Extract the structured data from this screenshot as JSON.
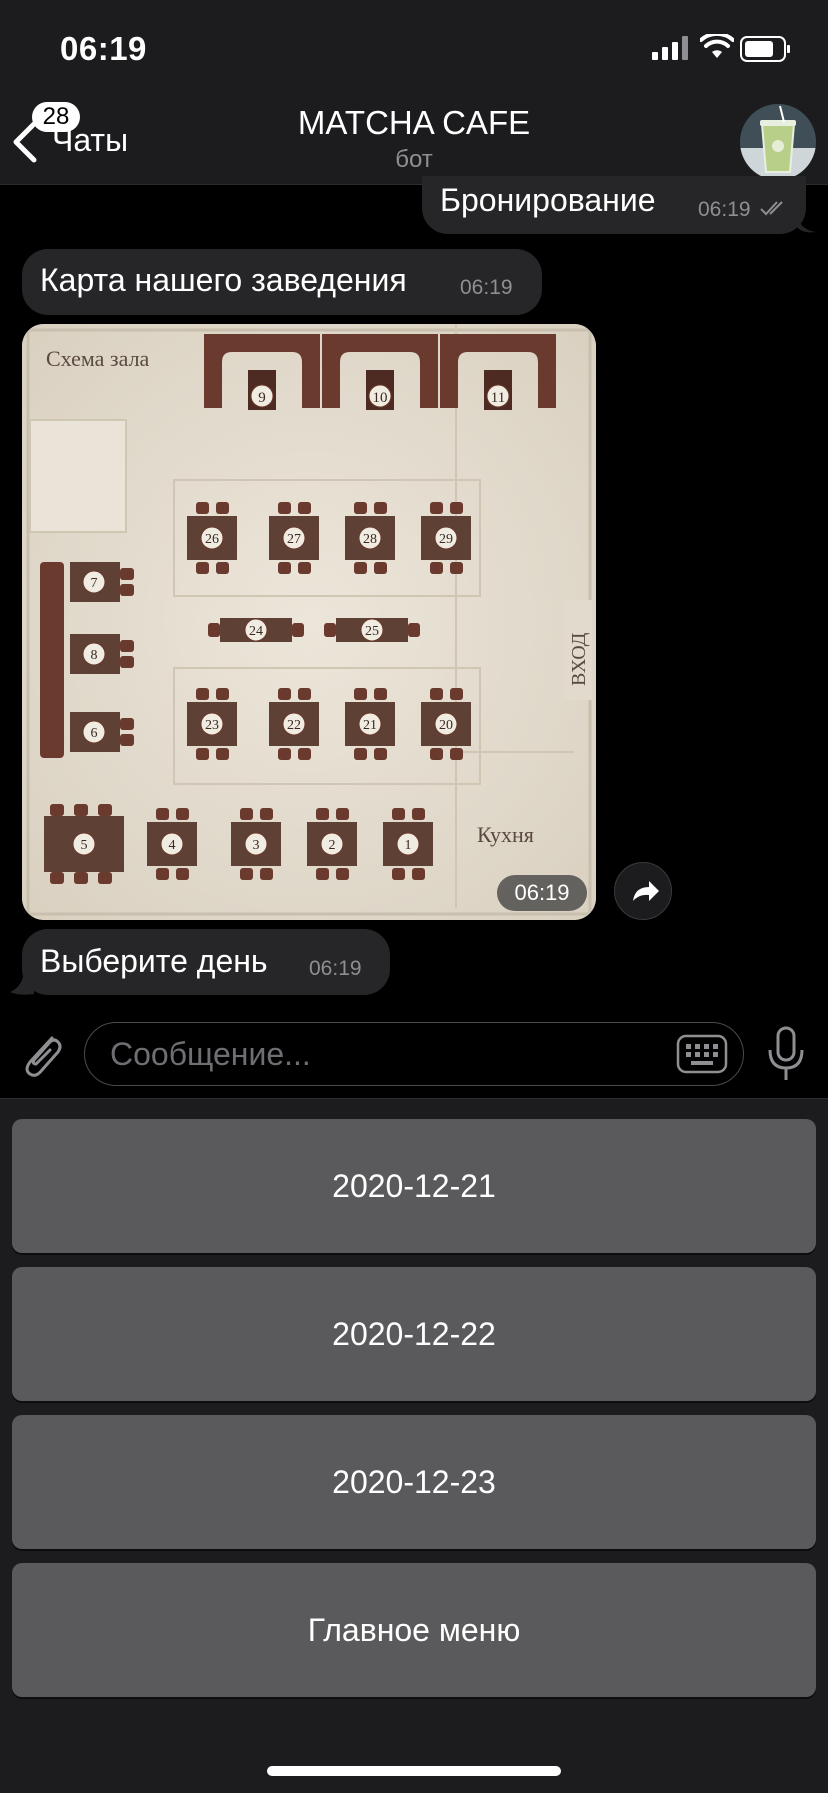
{
  "status_bar": {
    "time": "06:19"
  },
  "header": {
    "back_label": "Чаты",
    "unread_badge": "28",
    "title": "MATCHA CAFE",
    "subtitle": "бот"
  },
  "messages": [
    {
      "direction": "out",
      "text": "Бронирование",
      "time": "06:19"
    },
    {
      "direction": "in",
      "text": "Карта нашего заведения",
      "time": "06:19"
    },
    {
      "direction": "in",
      "type": "image",
      "time": "06:19"
    },
    {
      "direction": "in",
      "text": "Выберите день",
      "time": "06:19"
    }
  ],
  "floor_plan": {
    "title": "Схема зала",
    "entrance": "ВХОД",
    "kitchen": "Кухня",
    "tables": [
      "1",
      "2",
      "3",
      "4",
      "5",
      "6",
      "7",
      "8",
      "9",
      "10",
      "11",
      "20",
      "21",
      "22",
      "23",
      "24",
      "25",
      "26",
      "27",
      "28",
      "29"
    ]
  },
  "input": {
    "placeholder": "Сообщение..."
  },
  "keyboard": {
    "buttons": [
      "2020-12-21",
      "2020-12-22",
      "2020-12-23",
      "Главное меню"
    ]
  },
  "colors": {
    "background": "#000000",
    "bubble": "#262628",
    "button": "#5a5a5c",
    "plan_paper": "#e6dfd2",
    "plan_wood": "#6b3a2e"
  }
}
